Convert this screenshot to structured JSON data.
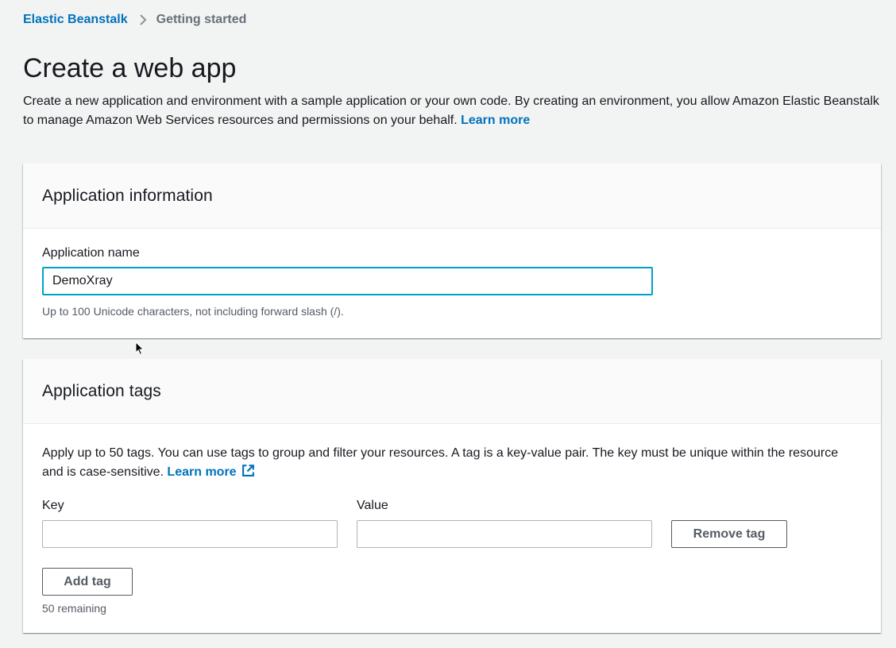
{
  "breadcrumb": {
    "items": [
      {
        "label": "Elastic Beanstalk"
      },
      {
        "label": "Getting started"
      }
    ]
  },
  "page": {
    "title": "Create a web app",
    "intro_text": "Create a new application and environment with a sample application or your own code. By creating an environment, you allow Amazon Elastic Beanstalk to manage Amazon Web Services resources and permissions on your behalf.",
    "intro_link": "Learn more"
  },
  "app_info": {
    "title": "Application information",
    "name_label": "Application name",
    "name_value": "DemoXray",
    "name_hint": "Up to 100 Unicode characters, not including forward slash (/)."
  },
  "app_tags": {
    "title": "Application tags",
    "description": "Apply up to 50 tags. You can use tags to group and filter your resources. A tag is a key-value pair. The key must be unique within the resource and is case-sensitive.",
    "learn_more": "Learn more",
    "key_label": "Key",
    "value_label": "Value",
    "key_value": "",
    "value_value": "",
    "remove_button": "Remove tag",
    "add_button": "Add tag",
    "remaining": "50 remaining"
  },
  "colors": {
    "link": "#0073bb",
    "focus_border": "#00a1c9",
    "page_bg": "#f2f3f3"
  },
  "icons": {
    "breadcrumb_separator": "chevron-right-icon",
    "external_link": "external-link-icon",
    "cursor": "mouse-pointer-icon"
  }
}
